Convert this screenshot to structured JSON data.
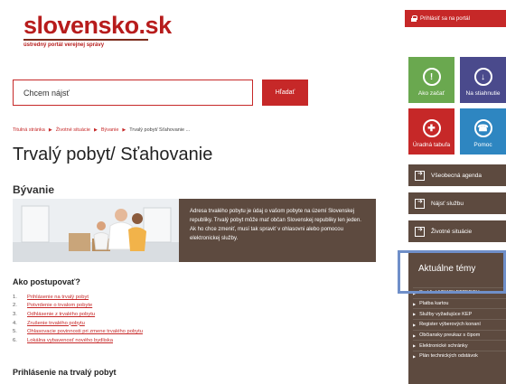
{
  "logo": {
    "name": "slovensko.sk",
    "tagline": "ústredný portál verejnej správy"
  },
  "login": {
    "label": "Prihlásiť sa na portál"
  },
  "search": {
    "placeholder": "Chcem nájsť",
    "button": "Hľadať"
  },
  "breadcrumb": [
    {
      "label": "Titulná stránka"
    },
    {
      "label": "Životné situácie"
    },
    {
      "label": "Bývanie"
    },
    {
      "label": "Trvalý pobyt/ Sťahovanie ..."
    }
  ],
  "page": {
    "title": "Trvalý pobyt/ Sťahovanie",
    "section": "Bývanie",
    "intro": "Adresa trvalého pobytu je údaj o vašom pobyte na území Slovenskej republiky. Trvalý pobyt môže mať občan Slovenskej republiky len jeden. Ak ho chce zmeniť, musí tak spraviť v ohlasovni alebo pomocou elektronickej služby.",
    "how_title": "Ako postupovať?",
    "steps": [
      {
        "num": "1.",
        "label": "Prihlásenie na trvalý pobyt"
      },
      {
        "num": "2.",
        "label": "Potvrdenie o trvalom pobyte"
      },
      {
        "num": "3.",
        "label": "Odhlásenie z trvalého pobytu"
      },
      {
        "num": "4.",
        "label": "Zrušenie trvalého pobytu"
      },
      {
        "num": "5.",
        "label": "Ohlasovacie povinnosti pri zmene trvalého pobytu"
      },
      {
        "num": "6.",
        "label": "Lokálna vybavenosť nového bydliska"
      }
    ],
    "subsection": "Prihlásenie na trvalý pobyt"
  },
  "tiles": [
    {
      "label": "Ako začať",
      "icon": "lightbulb-icon",
      "color": "#6aa84f"
    },
    {
      "label": "Na stiahnutie",
      "icon": "download-icon",
      "color": "#4a4a8c"
    },
    {
      "label": "Úradná tabuľa",
      "icon": "board-icon",
      "color": "#c62828"
    },
    {
      "label": "Pomoc",
      "icon": "phone-icon",
      "color": "#2e86c1"
    }
  ],
  "side_buttons": [
    {
      "label": "Všeobecná agenda"
    },
    {
      "label": "Nájsť službu"
    },
    {
      "label": "Životné situácie"
    }
  ],
  "topics": {
    "title": "Aktuálne témy",
    "items": [
      {
        "label": "Prehľad NEWSLETTEROV"
      },
      {
        "label": "Platba kartou"
      },
      {
        "label": "Služby vyžadujúce KEP"
      },
      {
        "label": "Register výberových konaní"
      },
      {
        "label": "Občiansky preukaz s čipom"
      },
      {
        "label": "Elektronické schránky"
      },
      {
        "label": "Plán technických odstávok"
      }
    ]
  },
  "colors": {
    "brand": "#c62828",
    "brown": "#5d4a3f",
    "green": "#6aa84f",
    "purple": "#4a4a8c",
    "blue": "#2e86c1"
  }
}
